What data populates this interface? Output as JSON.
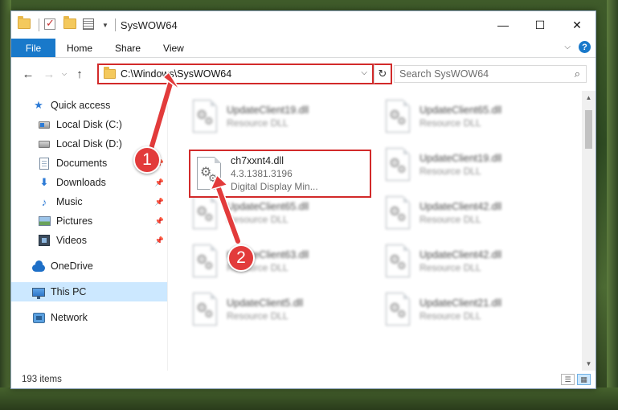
{
  "window": {
    "title": "SysWOW64",
    "controls": {
      "minimize": "—",
      "maximize": "☐",
      "close": "✕"
    }
  },
  "ribbon": {
    "tabs": [
      "File",
      "Home",
      "Share",
      "View"
    ],
    "help": "?"
  },
  "address": {
    "path": "C:\\Windows\\SysWOW64",
    "search_placeholder": "Search SysWOW64"
  },
  "nav": {
    "items": [
      {
        "label": "Quick access",
        "icon": "star-icon"
      },
      {
        "label": "Local Disk (C:)",
        "icon": "disk-icon"
      },
      {
        "label": "Local Disk (D:)",
        "icon": "disk-icon"
      },
      {
        "label": "Documents",
        "icon": "documents-icon"
      },
      {
        "label": "Downloads",
        "icon": "downloads-icon"
      },
      {
        "label": "Music",
        "icon": "music-icon"
      },
      {
        "label": "Pictures",
        "icon": "pictures-icon"
      },
      {
        "label": "Videos",
        "icon": "videos-icon"
      },
      {
        "label": "OneDrive",
        "icon": "onedrive-icon"
      },
      {
        "label": "This PC",
        "icon": "computer-icon"
      },
      {
        "label": "Network",
        "icon": "network-icon"
      }
    ]
  },
  "files": {
    "highlighted": {
      "name": "ch7xxnt4.dll",
      "version": "4.3.1381.3196",
      "description": "Digital Display Min..."
    },
    "background": [
      {
        "name": "UpdateClient19.dll",
        "type": "Resource DLL"
      },
      {
        "name": "UpdateClient65.dll",
        "type": "Resource DLL"
      },
      {
        "name": "UpdateClient19.dll",
        "type": "Resource DLL"
      },
      {
        "name": "UpdateClient65.dll",
        "type": "Resource DLL"
      },
      {
        "name": "UpdateClient42.dll",
        "type": "Resource DLL"
      },
      {
        "name": "UpdateClient63.dll",
        "type": "Resource DLL"
      },
      {
        "name": "UpdateClient42.dll",
        "type": "Resource DLL"
      },
      {
        "name": "UpdateClient5.dll",
        "type": "Resource DLL"
      },
      {
        "name": "UpdateClient21.dll",
        "type": "Resource DLL"
      }
    ]
  },
  "status": {
    "item_count": "193 items"
  },
  "annotations": {
    "step1": "1",
    "step2": "2",
    "color": "#e23b3b"
  }
}
